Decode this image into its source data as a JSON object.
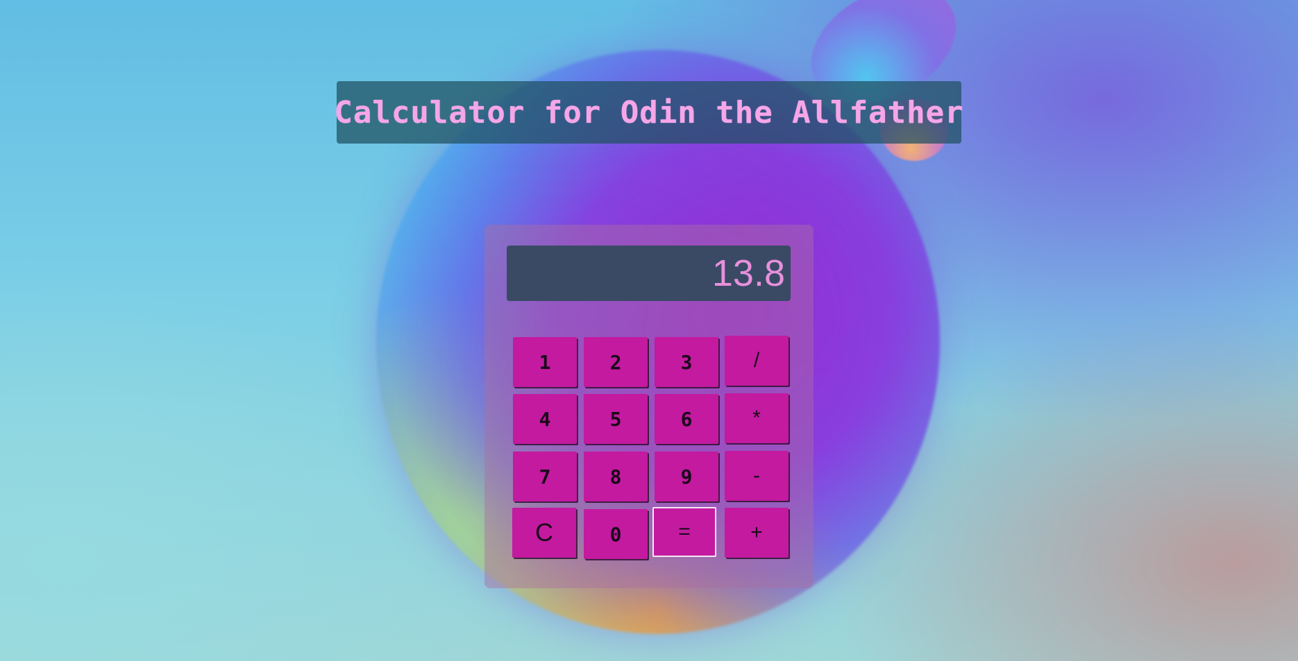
{
  "app": {
    "title": "Calculator for Odin the Allfather"
  },
  "display": {
    "value": "13.8"
  },
  "keys": {
    "k1": "1",
    "k2": "2",
    "k3": "3",
    "divide": "/",
    "k4": "4",
    "k5": "5",
    "k6": "6",
    "multiply": "*",
    "k7": "7",
    "k8": "8",
    "k9": "9",
    "subtract": "-",
    "clear": "C",
    "k0": "0",
    "equals": "=",
    "add": "+"
  },
  "colors": {
    "title_text": "#f6a6e8",
    "display_background": "#3a4a65",
    "display_text": "#e890dc",
    "key_background": "#c31aa0",
    "key_text": "#1a0a1a"
  }
}
